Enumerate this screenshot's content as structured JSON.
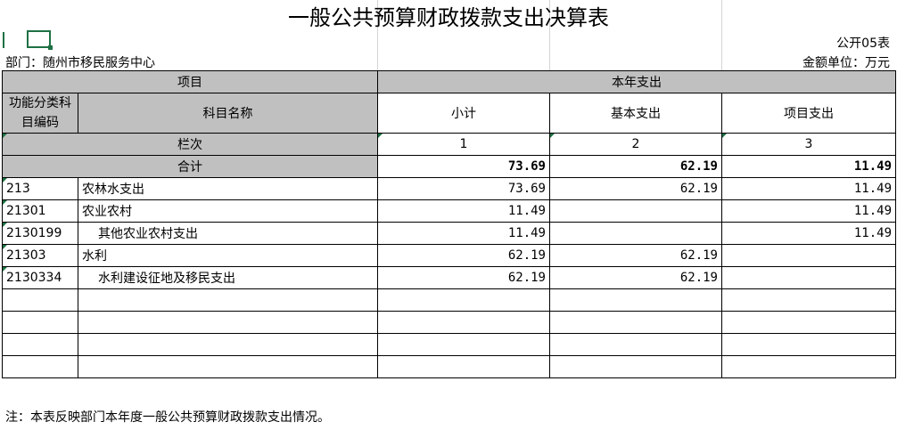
{
  "title": "一般公共预算财政拨款支出决算表",
  "form_no": "公开05表",
  "department": "部门：随州市移民服务中心",
  "unit": "金额单位：万元",
  "header": {
    "project": "项目",
    "current_year": "本年支出",
    "code_label": "功能分类科目编码",
    "name_label": "科目名称",
    "subtotal": "小计",
    "basic": "基本支出",
    "project_exp": "项目支出",
    "col_index_label": "栏次",
    "col1": "1",
    "col2": "2",
    "col3": "3"
  },
  "total": {
    "label": "合计",
    "subtotal": "73.69",
    "basic": "62.19",
    "project": "11.49"
  },
  "rows": [
    {
      "code": "213",
      "name": "农林水支出",
      "subtotal": "73.69",
      "basic": "62.19",
      "project": "11.49",
      "indent": false
    },
    {
      "code": "21301",
      "name": "农业农村",
      "subtotal": "11.49",
      "basic": "",
      "project": "11.49",
      "indent": false
    },
    {
      "code": "2130199",
      "name": "其他农业农村支出",
      "subtotal": "11.49",
      "basic": "",
      "project": "11.49",
      "indent": true
    },
    {
      "code": "21303",
      "name": "水利",
      "subtotal": "62.19",
      "basic": "62.19",
      "project": "",
      "indent": false
    },
    {
      "code": "2130334",
      "name": "水利建设征地及移民支出",
      "subtotal": "62.19",
      "basic": "62.19",
      "project": "",
      "indent": true
    }
  ],
  "note": "注：本表反映部门本年度一般公共预算财政拨款支出情况。"
}
